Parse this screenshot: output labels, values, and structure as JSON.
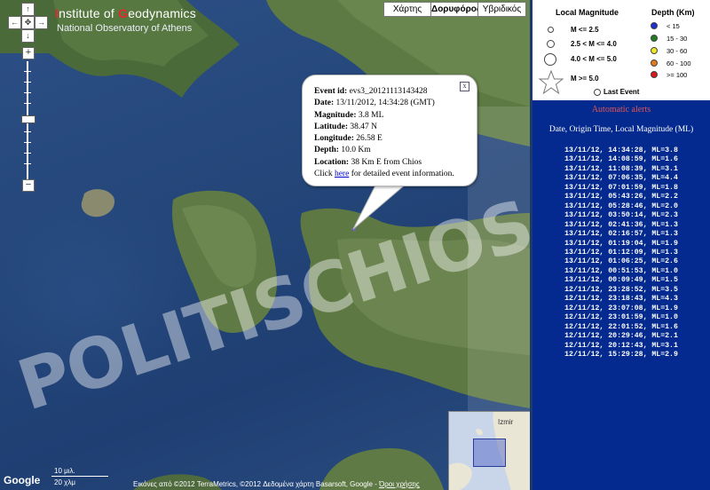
{
  "header": {
    "title_letter_1": "I",
    "title_part_1": "nstitute of ",
    "title_letter_2": "G",
    "title_part_2": "eodynamics",
    "subtitle": "National Observatory of Athens"
  },
  "map_types": {
    "map": "Χάρτης",
    "satellite": "Δορυφόρος",
    "hybrid": "Υβριδικός"
  },
  "nav": {
    "up": "↑",
    "left": "←",
    "center": "✥",
    "right": "→",
    "down": "↓",
    "zoom_in": "+",
    "zoom_out": "−"
  },
  "popup": {
    "event_id_label": "Event id:",
    "event_id": "evs3_20121113143428",
    "date_label": "Date:",
    "date": "13/11/2012, 14:34:28 (GMT)",
    "magnitude_label": "Magnitude:",
    "magnitude": "3.8 ML",
    "latitude_label": "Latitude:",
    "latitude": "38.47 N",
    "longitude_label": "Longitude:",
    "longitude": "26.58 E",
    "depth_label": "Depth:",
    "depth": "10.0 Km",
    "location_label": "Location:",
    "location": "38 Km E from Chios",
    "click_pre": "Click ",
    "click_link": "here",
    "click_post": " for detailed event information.",
    "close": "x"
  },
  "watermark": "POLITISCHIOS.GR",
  "scale": {
    "top": "10 μιλ.",
    "bottom": "20 χλμ"
  },
  "google_logo": "Google",
  "attribution_pre": "Εικόνες από ©2012 TerraMetrics, ©2012 Δεδομένα χάρτη Basarsoft, Google - ",
  "attribution_link": "Όροι χρήσης",
  "inset": {
    "label": "Izmir"
  },
  "legend": {
    "magnitude_title": "Local Magnitude",
    "depth_title": "Depth (Km)",
    "magnitude_classes": [
      "M <= 2.5",
      "2.5 < M <= 4.0",
      "4.0 < M <= 5.0",
      "M >= 5.0"
    ],
    "depth_classes": [
      {
        "label": "< 15",
        "color": "#1c2fd0"
      },
      {
        "label": "15 - 30",
        "color": "#1f7d1f"
      },
      {
        "label": "30 - 60",
        "color": "#f0e62a"
      },
      {
        "label": "60 - 100",
        "color": "#e07a1c"
      },
      {
        "label": ">= 100",
        "color": "#d41a1a"
      }
    ],
    "last_event": "Last Event"
  },
  "alerts": {
    "title": "Automatic alerts",
    "subtitle": "Date, Origin Time, Local Magnitude (ML)",
    "items": [
      "13/11/12, 14:34:28, ML=3.8",
      "13/11/12, 14:08:59, ML=1.6",
      "13/11/12, 11:08:39, ML=3.1",
      "13/11/12, 07:06:35, ML=4.4",
      "13/11/12, 07:01:59, ML=1.8",
      "13/11/12, 05:43:26, ML=2.2",
      "13/11/12, 05:28:46, ML=2.0",
      "13/11/12, 03:50:14, ML=2.3",
      "13/11/12, 02:41:36, ML=1.3",
      "13/11/12, 02:16:57, ML=1.3",
      "13/11/12, 01:19:04, ML=1.9",
      "13/11/12, 01:12:09, ML=1.3",
      "13/11/12, 01:06:25, ML=2.6",
      "13/11/12, 00:51:53, ML=1.0",
      "13/11/12, 00:09:49, ML=1.5",
      "12/11/12, 23:28:52, ML=3.5",
      "12/11/12, 23:18:43, ML=4.3",
      "12/11/12, 23:07:08, ML=1.9",
      "12/11/12, 23:01:59, ML=1.0",
      "12/11/12, 22:01:52, ML=1.6",
      "12/11/12, 20:29:46, ML=2.1",
      "12/11/12, 20:12:43, ML=3.1",
      "12/11/12, 15:29:28, ML=2.9"
    ]
  }
}
